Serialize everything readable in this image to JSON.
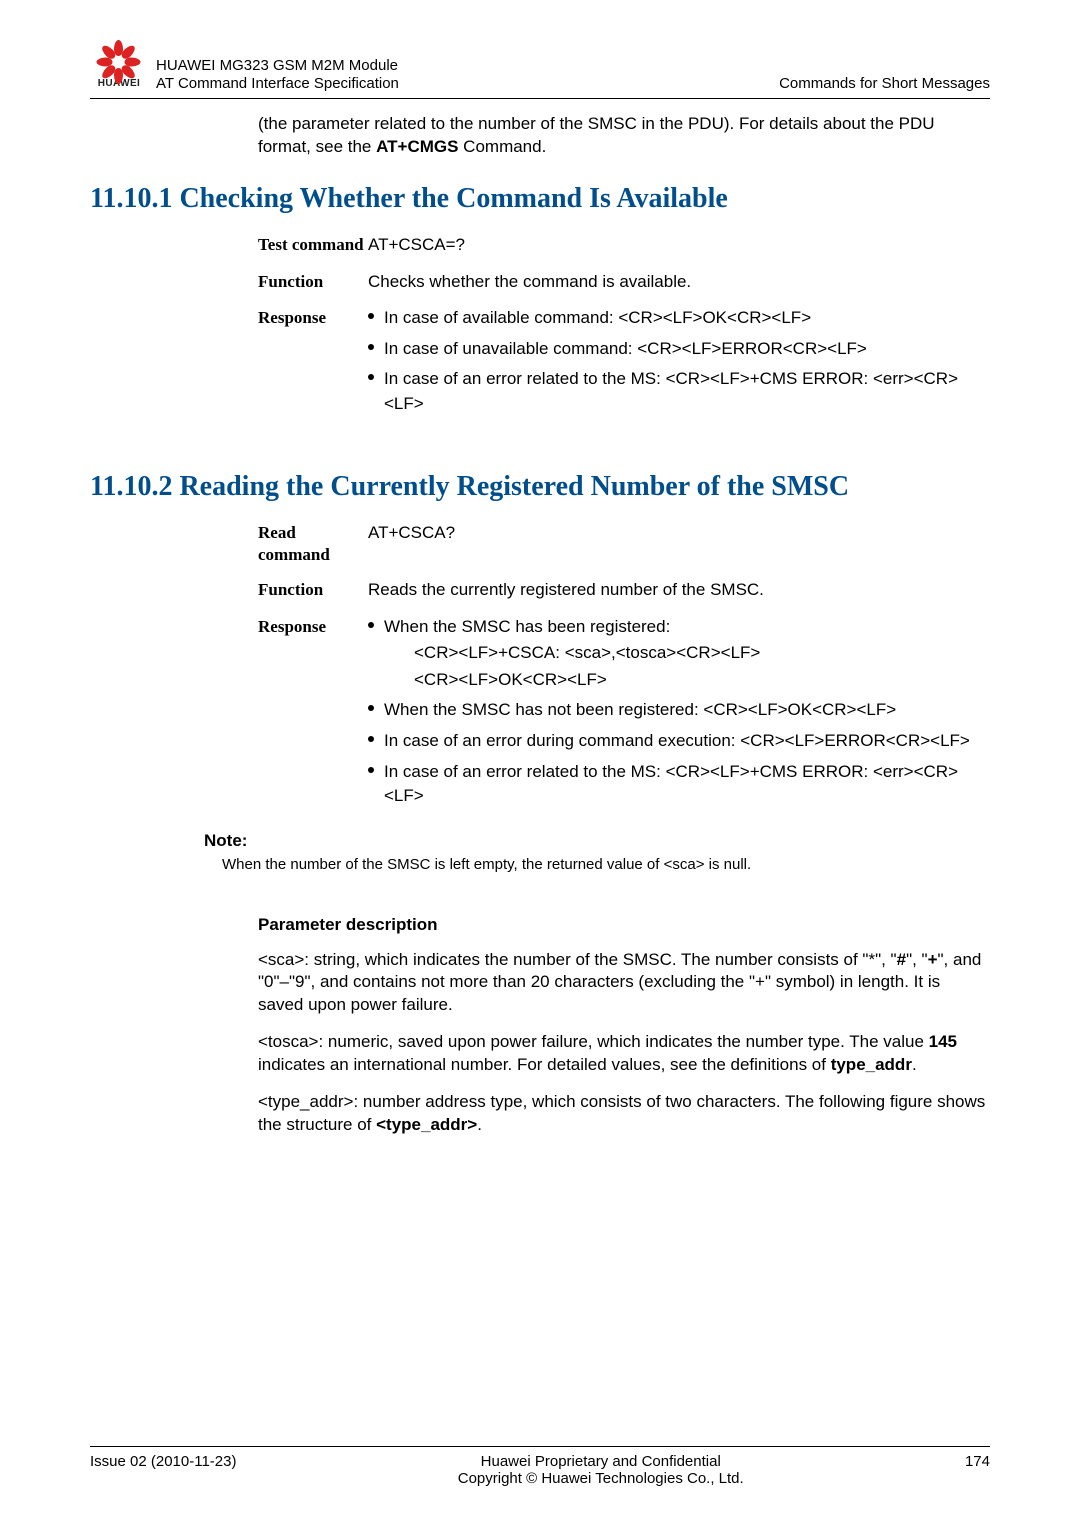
{
  "header": {
    "logo_text": "HUAWEI",
    "title_line1": "HUAWEI MG323 GSM M2M Module",
    "title_line2": "AT Command Interface Specification",
    "right": "Commands for Short Messages"
  },
  "intro_p": "(the parameter related to the number of the SMSC in the PDU). For details about the PDU format, see the AT+CMGS Command.",
  "sec1": {
    "heading": "11.10.1 Checking Whether the Command Is Available",
    "rows": {
      "test_label": "Test command",
      "test_value": "AT+CSCA=?",
      "func_label": "Function",
      "func_value": "Checks whether the command is available.",
      "resp_label": "Response",
      "resp_b1": "In case of available command: <CR><LF>OK<CR><LF>",
      "resp_b2": "In case of unavailable command: <CR><LF>ERROR<CR><LF>",
      "resp_b3": "In case of an error related to the MS: <CR><LF>+CMS ERROR: <err><CR><LF>"
    }
  },
  "sec2": {
    "heading": "11.10.2 Reading the Currently Registered Number of the SMSC",
    "rows": {
      "read_label": "Read command",
      "read_value": "AT+CSCA?",
      "func_label": "Function",
      "func_value": "Reads the currently registered number of the SMSC.",
      "resp_label": "Response",
      "resp_b1": "When the SMSC has been registered:",
      "resp_b1_s1": "<CR><LF>+CSCA: <sca>,<tosca><CR><LF>",
      "resp_b1_s2": "<CR><LF>OK<CR><LF>",
      "resp_b2": "When the SMSC has not been registered: <CR><LF>OK<CR><LF>",
      "resp_b3": "In case of an error during command execution: <CR><LF>ERROR<CR><LF>",
      "resp_b4": "In case of an error related to the MS: <CR><LF>+CMS ERROR: <err><CR><LF>"
    },
    "note_label": "Note:",
    "note_text": "When the number of the SMSC is left empty, the returned value of <sca> is null."
  },
  "params": {
    "heading": "Parameter description",
    "p1": "<sca>: string, which indicates the number of the SMSC. The number consists of \"*\", \"#\", \"+\", and \"0\"–\"9\", and contains not more than 20 characters (excluding the \"+\" symbol) in length. It is saved upon power failure.",
    "p2": "<tosca>: numeric, saved upon power failure, which indicates the number type. The value 145 indicates an international number. For detailed values, see the definitions of type_addr.",
    "p3": "<type_addr>: number address type, which consists of two characters. The following figure shows the structure of <type_addr>."
  },
  "footer": {
    "left": "Issue 02 (2010-11-23)",
    "center1": "Huawei Proprietary and Confidential",
    "center2": "Copyright © Huawei Technologies Co., Ltd.",
    "right": "174"
  }
}
